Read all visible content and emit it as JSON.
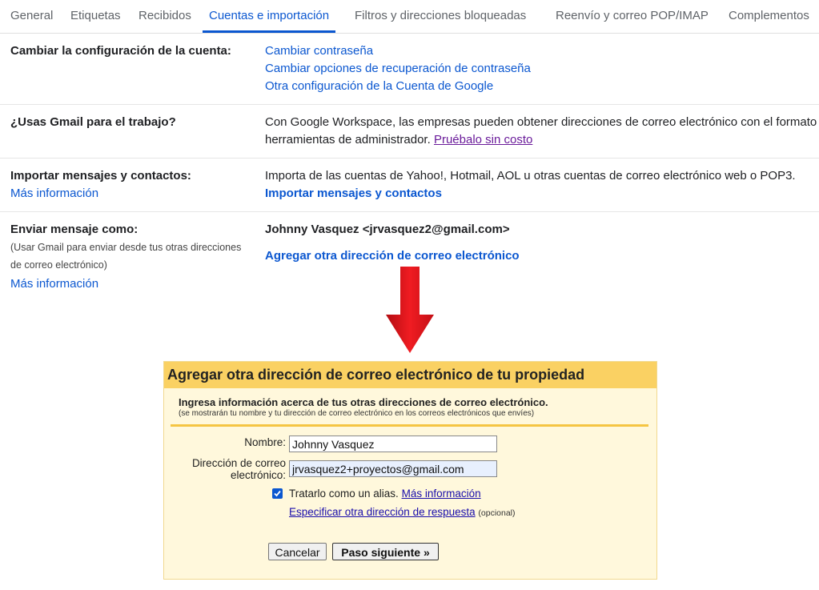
{
  "tabs": [
    {
      "label": "General"
    },
    {
      "label": "Etiquetas"
    },
    {
      "label": "Recibidos"
    },
    {
      "label": "Cuentas e importación"
    },
    {
      "label": "Filtros y direcciones bloqueadas"
    },
    {
      "label": "Reenvío y correo POP/IMAP"
    },
    {
      "label": "Complementos"
    }
  ],
  "account": {
    "label": "Cambiar la configuración de la cuenta:",
    "links": [
      "Cambiar contraseña",
      "Cambiar opciones de recuperación de contraseña",
      "Otra configuración de la Cuenta de Google"
    ]
  },
  "work": {
    "label": "¿Usas Gmail para el trabajo?",
    "line1": "Con Google Workspace, las empresas pueden obtener direcciones de correo electrónico con el formato",
    "line2": "herramientas de administrador.",
    "try_link": "Pruébalo sin costo"
  },
  "import": {
    "label": "Importar mensajes y contactos:",
    "more": "Más información",
    "desc": "Importa de las cuentas de Yahoo!, Hotmail, AOL u otras cuentas de correo electrónico web o POP3.",
    "action": "Importar mensajes y contactos"
  },
  "sendas": {
    "label": "Enviar mensaje como:",
    "note1": "(Usar Gmail para enviar desde tus otras direcciones",
    "note2": "de correo electrónico)",
    "more": "Más información",
    "identity": "Johnny Vasquez <jrvasquez2@gmail.com>",
    "add_link": "Agregar otra dirección de correo electrónico"
  },
  "dialog": {
    "title": "Agregar otra dirección de correo electrónico de tu propiedad",
    "heading": "Ingresa información acerca de tus otras direcciones de correo electrónico.",
    "subheading": "(se mostrarán tu nombre y tu dirección de correo electrónico en los correos electrónicos que envíes)",
    "name_label": "Nombre:",
    "name_value": "Johnny Vasquez",
    "email_label_1": "Dirección de correo",
    "email_label_2": "electrónico:",
    "email_value": "jrvasquez2+proyectos@gmail.com",
    "alias_checked": true,
    "alias_text": "Tratarlo como un alias.",
    "alias_more": "Más información",
    "reply_link": "Especificar otra dirección de respuesta",
    "optional": "(opcional)",
    "cancel": "Cancelar",
    "next": "Paso siguiente »"
  },
  "colors": {
    "accent": "#0b57d0",
    "dialog_header": "#fad163",
    "dialog_bg": "#fff8dc",
    "arrow": "#e8141c"
  }
}
